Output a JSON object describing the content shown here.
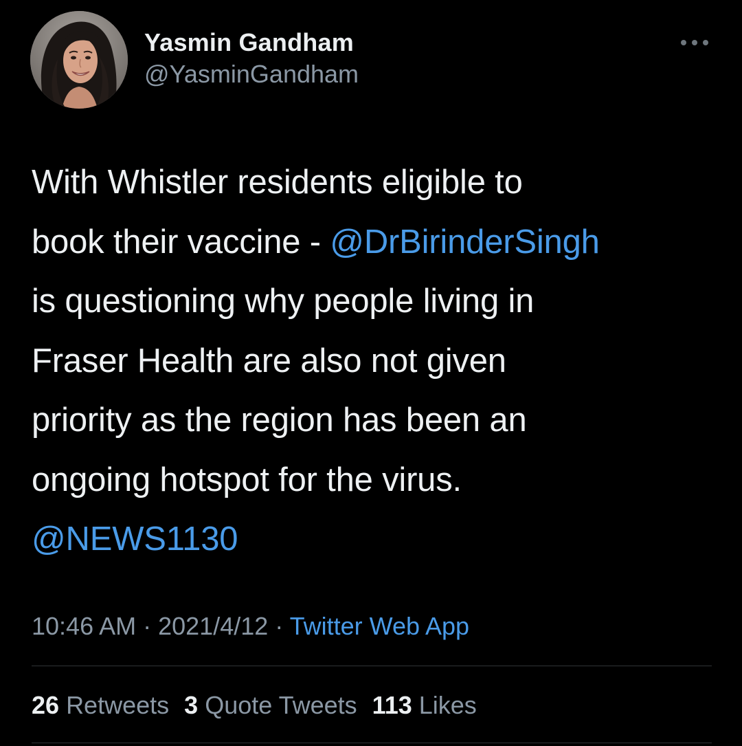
{
  "author": {
    "display_name": "Yasmin Gandham",
    "handle": "@YasminGandham"
  },
  "tweet": {
    "lines": [
      [
        {
          "text": "With Whistler residents eligible to",
          "mention": false
        }
      ],
      [
        {
          "text": "book their vaccine - ",
          "mention": false
        },
        {
          "text": "@DrBirinderSingh",
          "mention": true
        }
      ],
      [
        {
          "text": "is questioning why people living in",
          "mention": false
        }
      ],
      [
        {
          "text": "Fraser Health are also not given",
          "mention": false
        }
      ],
      [
        {
          "text": "priority as the region has been an",
          "mention": false
        }
      ],
      [
        {
          "text": "ongoing hotspot for the virus.",
          "mention": false
        }
      ],
      [
        {
          "text": "@NEWS1130",
          "mention": true
        }
      ]
    ]
  },
  "meta": {
    "time": "10:46 AM",
    "separator": " · ",
    "date": "2021/4/12",
    "source": "Twitter Web App"
  },
  "stats": {
    "retweets_count": "26",
    "retweets_label": "Retweets",
    "quotes_count": "3",
    "quotes_label": "Quote Tweets",
    "likes_count": "113",
    "likes_label": "Likes"
  },
  "colors": {
    "background": "#000000",
    "text": "#eef1f3",
    "secondary": "#8b98a5",
    "link": "#4a9be8",
    "divider": "#2f3336"
  },
  "icons": {
    "more": "more-dots-icon"
  }
}
